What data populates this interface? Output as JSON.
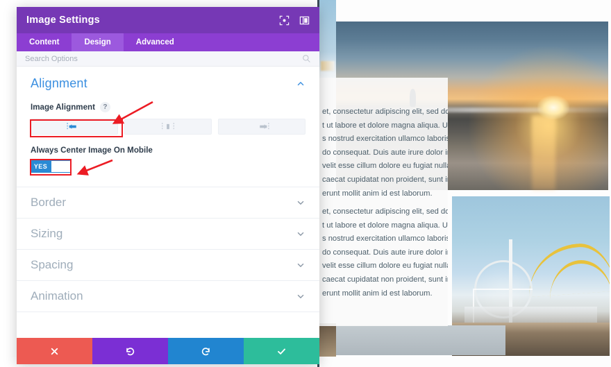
{
  "panel": {
    "title": "Image Settings",
    "header_icons": [
      {
        "name": "focus-target-icon",
        "label": "Focus"
      },
      {
        "name": "layout-panel-icon",
        "label": "Layout"
      }
    ],
    "tabs": [
      {
        "label": "Content",
        "active": false
      },
      {
        "label": "Design",
        "active": true
      },
      {
        "label": "Advanced",
        "active": false
      }
    ],
    "search": {
      "placeholder": "Search Options",
      "value": ""
    },
    "alignment_section": {
      "title": "Alignment",
      "expanded": true,
      "image_alignment": {
        "label": "Image Alignment",
        "help": "?",
        "options": [
          {
            "name": "align-left",
            "selected": true
          },
          {
            "name": "align-center",
            "selected": false
          },
          {
            "name": "align-right",
            "selected": false
          }
        ]
      },
      "always_center_mobile": {
        "label": "Always Center Image On Mobile",
        "state": "YES"
      }
    },
    "collapsed_sections": [
      {
        "label": "Border"
      },
      {
        "label": "Sizing"
      },
      {
        "label": "Spacing"
      },
      {
        "label": "Animation"
      }
    ],
    "footer_buttons": [
      {
        "name": "close-button",
        "icon": "x-icon",
        "color": "#ed5a52"
      },
      {
        "name": "undo-button",
        "icon": "undo-icon",
        "color": "#7b2fd4"
      },
      {
        "name": "redo-button",
        "icon": "redo-icon",
        "color": "#2185d0"
      },
      {
        "name": "save-button",
        "icon": "check-icon",
        "color": "#2dbd9b"
      }
    ]
  },
  "preview": {
    "text_block_one": [
      "et, consectetur adipiscing elit, sed do",
      "t ut labore et dolore magna aliqua. Ut",
      "s nostrud exercitation ullamco laboris",
      "do consequat. Duis aute irure dolor in",
      " velit esse cillum dolore eu fugiat nulla",
      "caecat cupidatat non proident, sunt in",
      "erunt mollit anim id est laborum."
    ],
    "text_block_two": [
      "et, consectetur adipiscing elit, sed do",
      "t ut labore et dolore magna aliqua. Ut",
      "s nostrud exercitation ullamco laboris",
      "do consequat. Duis aute irure dolor in",
      " velit esse cillum dolore eu fugiat nulla",
      "caecat cupidatat non proident, sunt in",
      "erunt mollit anim id est laborum."
    ],
    "images": [
      {
        "name": "beach-sunset-photo"
      },
      {
        "name": "pier-ferris-wheel-photo"
      }
    ]
  },
  "annotations": {
    "highlight_color": "#ec1c24",
    "items": [
      {
        "name": "align-left-highlight"
      },
      {
        "name": "mobile-toggle-highlight"
      },
      {
        "name": "arrow-to-align"
      },
      {
        "name": "arrow-to-toggle"
      }
    ]
  }
}
